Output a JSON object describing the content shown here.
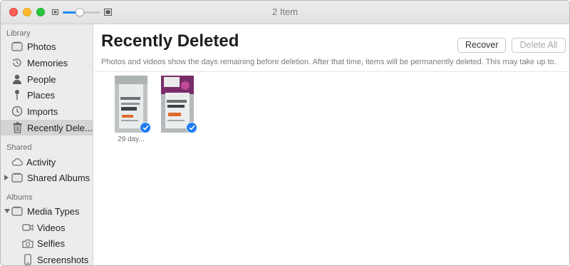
{
  "window": {
    "title": "2 Item"
  },
  "zoom": {
    "level": 0.45
  },
  "sidebar": {
    "sections": [
      {
        "header": "Library",
        "items": [
          {
            "label": "Photos",
            "icon": "photos-icon"
          },
          {
            "label": "Memories",
            "icon": "memories-icon"
          },
          {
            "label": "People",
            "icon": "people-icon"
          },
          {
            "label": "Places",
            "icon": "places-pin-icon"
          },
          {
            "label": "Imports",
            "icon": "imports-clock-icon"
          },
          {
            "label": "Recently Dele...",
            "icon": "trash-icon",
            "selected": true
          }
        ]
      },
      {
        "header": "Shared",
        "items": [
          {
            "label": "Activity",
            "icon": "cloud-icon"
          },
          {
            "label": "Shared Albums",
            "icon": "shared-album-icon",
            "disclosure": "collapsed"
          }
        ]
      },
      {
        "header": "Albums",
        "items": [
          {
            "label": "Media Types",
            "icon": "album-folder-icon",
            "disclosure": "expanded"
          },
          {
            "label": "Videos",
            "icon": "video-camera-icon"
          },
          {
            "label": "Selfies",
            "icon": "selfie-camera-icon"
          },
          {
            "label": "Screenshots",
            "icon": "phone-screenshot-icon"
          }
        ]
      }
    ]
  },
  "main": {
    "title": "Recently Deleted",
    "recover_label": "Recover",
    "delete_all_label": "Delete All",
    "notice": "Photos and videos show the days remaining before deletion. After that time, items will be permanently deleted. This may take up to...",
    "items": [
      {
        "caption": "29 day...",
        "selected": true
      },
      {
        "caption": "",
        "selected": true
      }
    ]
  },
  "colors": {
    "accent": "#1e7ef0",
    "sidebar_bg": "#ececec",
    "selected_row": "#d4d4d4",
    "close": "#fd5f57",
    "minimize": "#febc2e",
    "maximize": "#28c840"
  }
}
